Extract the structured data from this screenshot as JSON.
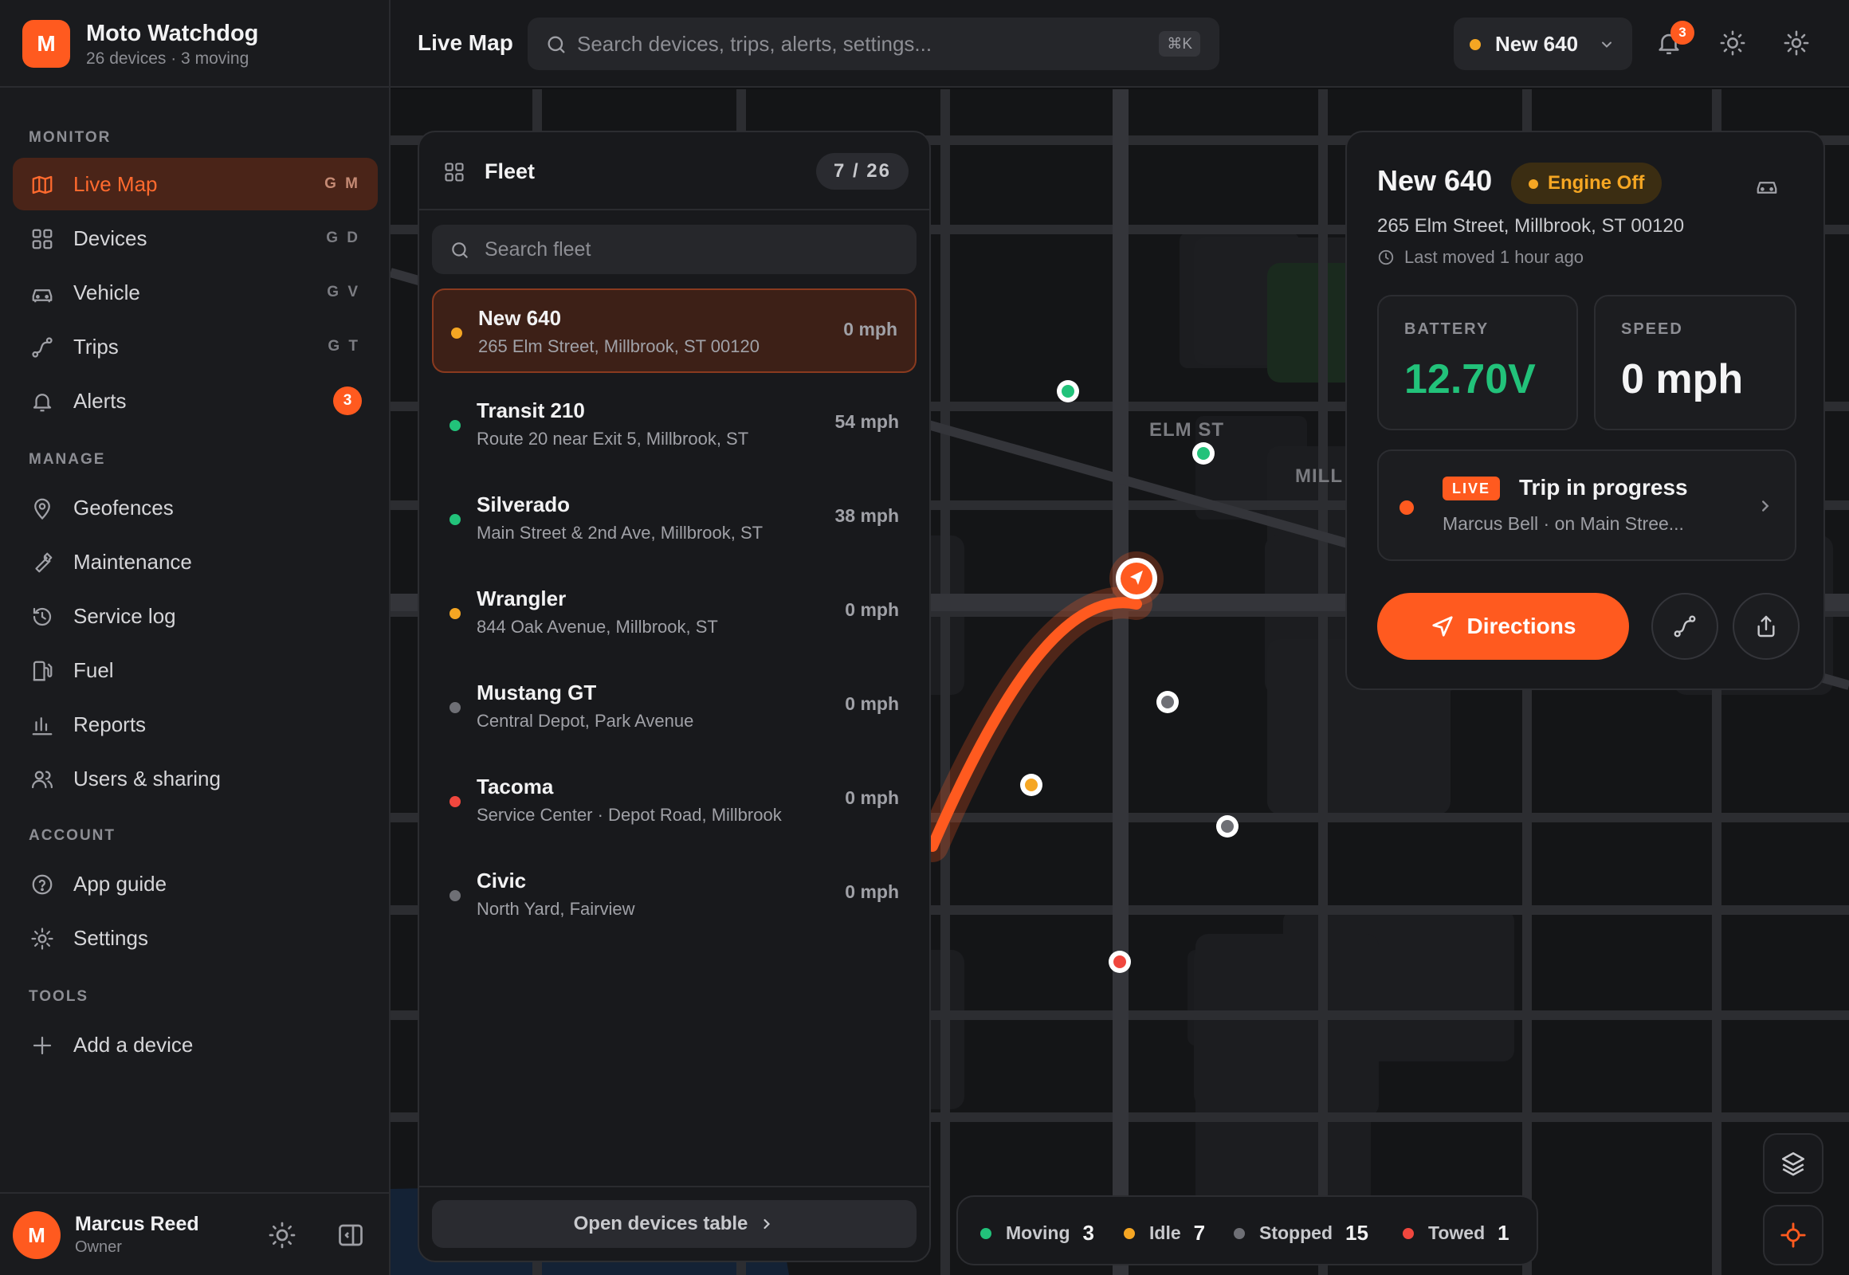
{
  "brand": {
    "logo_letter": "M",
    "name": "Moto Watchdog",
    "subtitle": "26 devices · 3 moving"
  },
  "sidebar": {
    "sections": {
      "monitor": "MONITOR",
      "manage": "MANAGE",
      "account": "ACCOUNT",
      "tools": "TOOLS"
    },
    "monitor_items": [
      {
        "label": "Live Map",
        "shortcut": "G M",
        "icon": "map-icon",
        "active": true
      },
      {
        "label": "Devices",
        "shortcut": "G D",
        "icon": "grid-icon"
      },
      {
        "label": "Vehicle",
        "shortcut": "G V",
        "icon": "car-icon"
      },
      {
        "label": "Trips",
        "shortcut": "G T",
        "icon": "route-icon"
      },
      {
        "label": "Alerts",
        "badge": "3",
        "icon": "bell-icon"
      }
    ],
    "manage_items": [
      {
        "label": "Geofences",
        "icon": "pin-icon"
      },
      {
        "label": "Maintenance",
        "icon": "wrench-icon"
      },
      {
        "label": "Service log",
        "icon": "history-icon"
      },
      {
        "label": "Fuel",
        "icon": "fuel-icon"
      },
      {
        "label": "Reports",
        "icon": "bar-chart-icon"
      },
      {
        "label": "Users & sharing",
        "icon": "users-icon"
      }
    ],
    "account_items": [
      {
        "label": "App guide",
        "icon": "help-icon"
      },
      {
        "label": "Settings",
        "icon": "gear-icon"
      }
    ],
    "tools_items": [
      {
        "label": "Add a device",
        "icon": "plus-icon"
      }
    ],
    "user": {
      "initial": "M",
      "name": "Marcus Reed",
      "role": "Owner"
    }
  },
  "topbar": {
    "title": "Live Map",
    "search_placeholder": "Search devices, trips, alerts, settings...",
    "search_shortcut": "⌘K",
    "vehicle_selected": "New 640",
    "notification_count": "3"
  },
  "map": {
    "street_labels": [
      "ELM ST",
      "MILL"
    ]
  },
  "fleet": {
    "title": "Fleet",
    "count": "7 / 26",
    "search_placeholder": "Search fleet",
    "vehicles": [
      {
        "name": "New 640",
        "address": "265 Elm Street, Millbrook, ST 00120",
        "speed": "0 mph",
        "status": "idle",
        "selected": true
      },
      {
        "name": "Transit 210",
        "address": "Route 20 near Exit 5, Millbrook, ST",
        "speed": "54 mph",
        "status": "moving"
      },
      {
        "name": "Silverado",
        "address": "Main Street & 2nd Ave, Millbrook, ST",
        "speed": "38 mph",
        "status": "moving"
      },
      {
        "name": "Wrangler",
        "address": "844 Oak Avenue, Millbrook, ST",
        "speed": "0 mph",
        "status": "idle"
      },
      {
        "name": "Mustang GT",
        "address": "Central Depot, Park Avenue",
        "speed": "0 mph",
        "status": "stopped"
      },
      {
        "name": "Tacoma",
        "address": "Service Center · Depot Road, Millbrook",
        "speed": "0 mph",
        "status": "towed"
      },
      {
        "name": "Civic",
        "address": "North Yard, Fairview",
        "speed": "0 mph",
        "status": "stopped"
      }
    ],
    "footer_button": "Open devices table"
  },
  "detail": {
    "name": "New 640",
    "status": "Engine Off",
    "address": "265 Elm Street, Millbrook, ST 00120",
    "last_moved": "Last moved 1 hour ago",
    "battery_label": "BATTERY",
    "battery_value": "12.70V",
    "speed_label": "SPEED",
    "speed_value": "0 mph",
    "trip_live": "LIVE",
    "trip_title": "Trip in progress",
    "trip_sub": "Marcus Bell · on Main Stree...",
    "directions_label": "Directions"
  },
  "legend": {
    "items": [
      {
        "label": "Moving",
        "count": "3",
        "color": "#22c27a"
      },
      {
        "label": "Idle",
        "count": "7",
        "color": "#f5a623"
      },
      {
        "label": "Stopped",
        "count": "15",
        "color": "#6e6f75"
      },
      {
        "label": "Towed",
        "count": "1",
        "color": "#f0473e"
      }
    ]
  },
  "colors": {
    "accent": "#ff5a1f",
    "moving": "#22c27a",
    "idle": "#f5a623",
    "stopped": "#6e6f75",
    "towed": "#f0473e"
  }
}
